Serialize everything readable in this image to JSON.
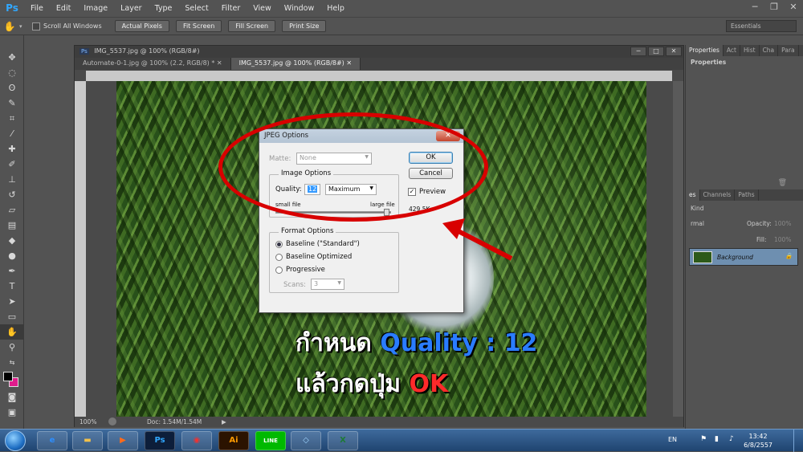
{
  "app": {
    "logo": "Ps"
  },
  "menu": [
    "File",
    "Edit",
    "Image",
    "Layer",
    "Type",
    "Select",
    "Filter",
    "View",
    "Window",
    "Help"
  ],
  "options": {
    "scroll_all": "Scroll All Windows",
    "actual_pixels": "Actual Pixels",
    "fit_screen": "Fit Screen",
    "fill_screen": "Fill Screen",
    "print_size": "Print Size",
    "workspace": "Essentials"
  },
  "document": {
    "title": "IMG_5537.jpg @ 100% (RGB/8#)",
    "tabs": [
      "Automate-0-1.jpg @ 100% (2.2, RGB/8) *",
      "IMG_5537.jpg @ 100% (RGB/8#)"
    ],
    "zoom": "100%",
    "doc_info": "Doc: 1.54M/1.54M"
  },
  "panels": {
    "top_tabs": [
      "Properties",
      "Act",
      "Hist",
      "Cha",
      "Para"
    ],
    "properties_title": "Properties",
    "layer_tabs": [
      "es",
      "Channels",
      "Paths"
    ],
    "kind": "Kind",
    "blend": "rmal",
    "opacity_label": "Opacity:",
    "opacity_value": "100%",
    "fill_label": "Fill:",
    "fill_value": "100%",
    "layer_name": "Background"
  },
  "dialog": {
    "title": "JPEG Options",
    "close": "✕",
    "matte_label": "Matte:",
    "matte_value": "None",
    "ok": "OK",
    "cancel": "Cancel",
    "image_options": "Image Options",
    "quality_label": "Quality:",
    "quality_value": "12",
    "quality_preset": "Maximum",
    "small_file": "small file",
    "large_file": "large file",
    "preview_label": "Preview",
    "file_size": "429.5K",
    "format_options": "Format Options",
    "format_choices": [
      "Baseline (\"Standard\")",
      "Baseline Optimized",
      "Progressive"
    ],
    "scans_label": "Scans:",
    "scans_value": "3",
    "quality_slider_level": 1.0
  },
  "annotation": {
    "line1_prefix": "กำหนด ",
    "line1_highlight": "Quality : 12",
    "line2_prefix": "แล้วกดปุ่ม ",
    "line2_highlight": "OK",
    "color": "#d80000"
  },
  "taskbar": {
    "lang": "EN",
    "time": "13:42",
    "date": "6/8/2557",
    "apps": [
      "Ps",
      "Ai",
      "LINE"
    ]
  }
}
